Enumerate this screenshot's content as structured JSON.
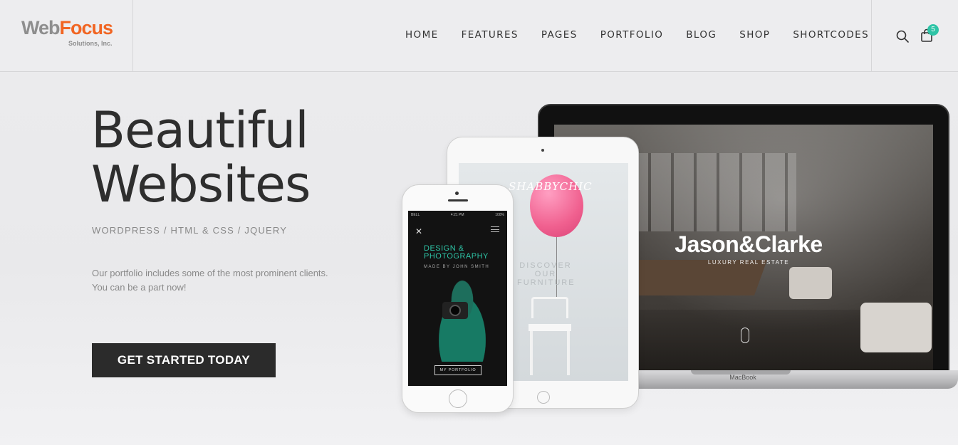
{
  "header": {
    "logo_web": "Web",
    "logo_focus": "Focus",
    "logo_sub": "Solutions, Inc.",
    "nav": [
      "HOME",
      "FEATURES",
      "PAGES",
      "PORTFOLIO",
      "BLOG",
      "SHOP",
      "SHORTCODES"
    ],
    "cart_count": "5",
    "icons": [
      "search-icon",
      "shopping-bag-icon"
    ]
  },
  "hero": {
    "title_line1": "Beautiful",
    "title_line2": "Websites",
    "subtitle": "WORDPRESS / HTML & CSS / JQUERY",
    "desc_line1": "Our portfolio includes some of the most prominent clients.",
    "desc_line2": "You can be a part now!",
    "cta": "GET STARTED TODAY"
  },
  "devices": {
    "laptop": {
      "brand": "Jason&Clarke",
      "tagline": "LUXURY REAL ESTATE",
      "label": "MacBook"
    },
    "tablet": {
      "brand": "SHABBYCHIC",
      "discover1": "DISCOVER",
      "discover2": "OUR",
      "discover3": "FURNITURE"
    },
    "phone": {
      "status_left": "BELL",
      "status_time": "4:21 PM",
      "status_right": "100%",
      "heading1": "DESIGN &",
      "heading2": "PHOTOGRAPHY",
      "by": "MADE BY JOHN SMITH",
      "button": "MY PORTFOLIO"
    }
  },
  "colors": {
    "accent": "#f16522",
    "badge": "#2ec4a6",
    "cta_bg": "#2b2b2b"
  }
}
